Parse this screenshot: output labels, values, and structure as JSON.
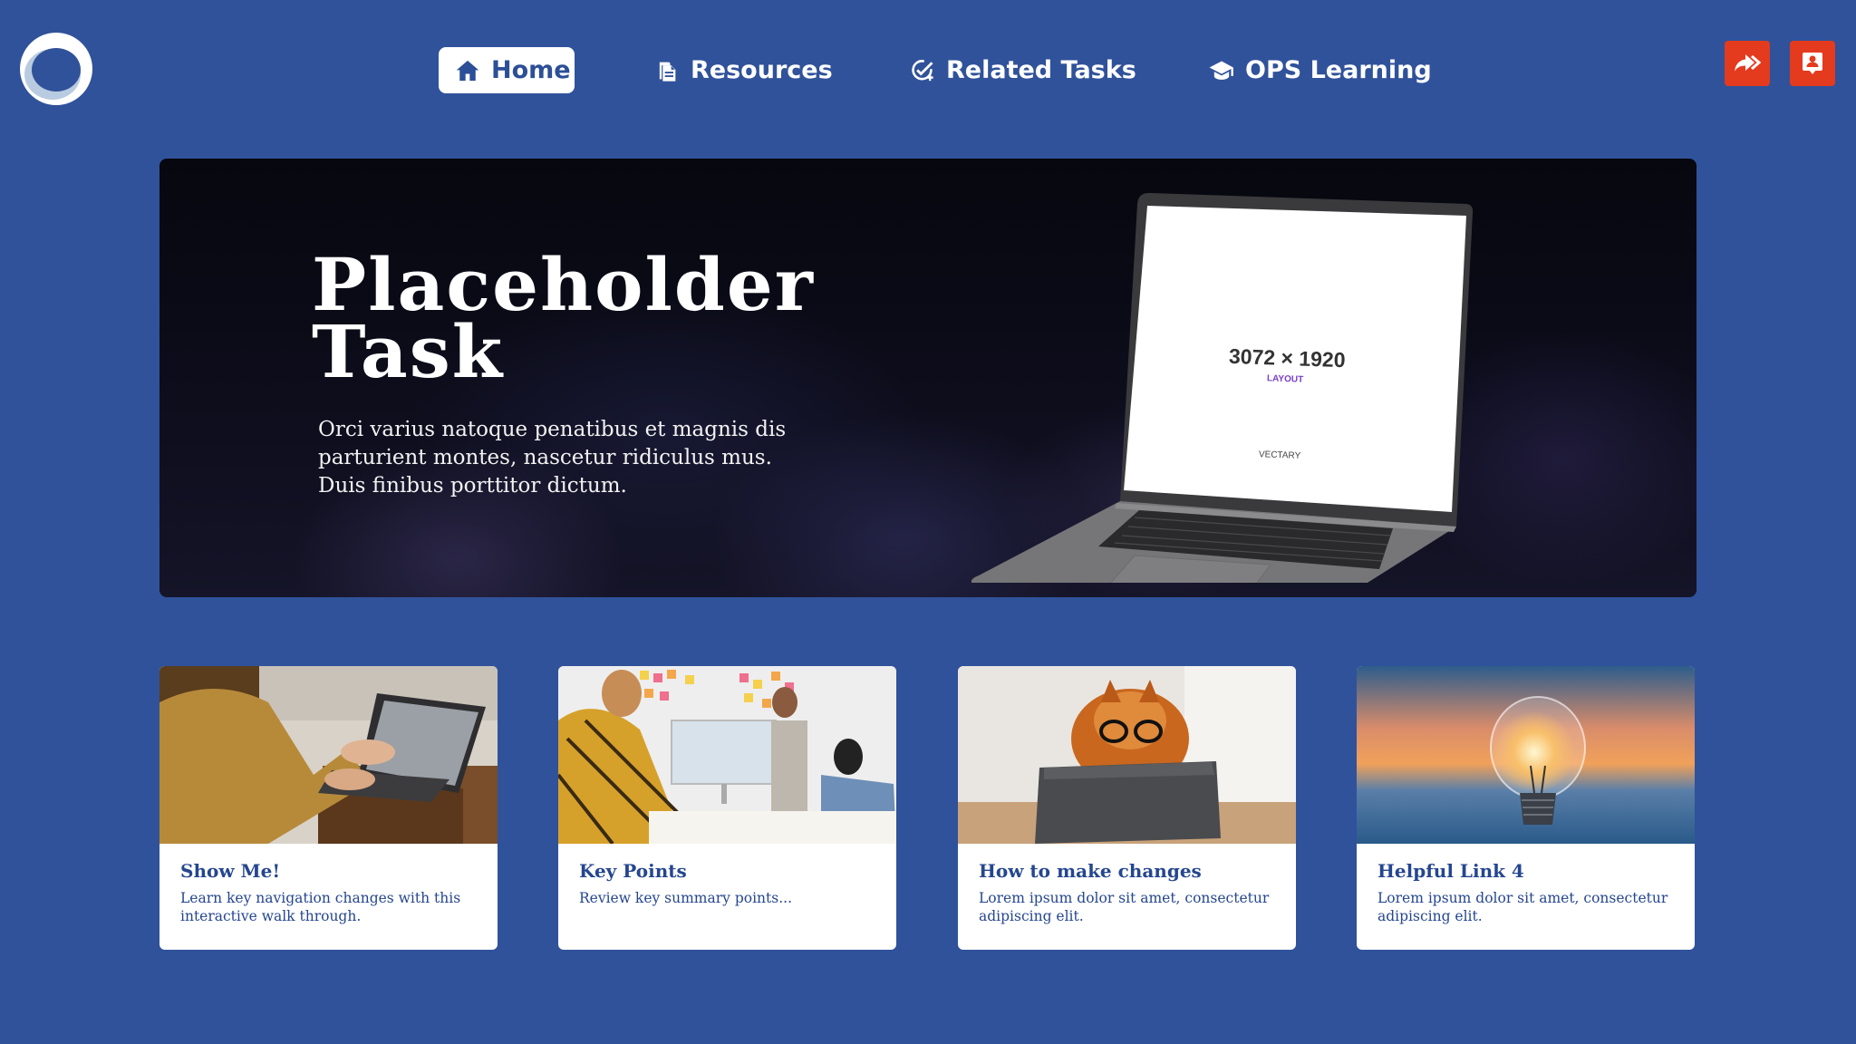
{
  "colors": {
    "background": "#30529a",
    "accent_red": "#e43a1e",
    "card_text": "#25468f",
    "nav_active_bg": "#ffffff"
  },
  "header": {
    "logo_icon": "ring-logo-icon",
    "nav": [
      {
        "label": "Home",
        "icon": "home-icon",
        "active": true
      },
      {
        "label": "Resources",
        "icon": "document-icon",
        "active": false
      },
      {
        "label": "Related Tasks",
        "icon": "check-badge-icon",
        "active": false
      },
      {
        "label": "OPS Learning",
        "icon": "graduation-cap-icon",
        "active": false
      }
    ],
    "actions": [
      {
        "icon": "share-forward-icon"
      },
      {
        "icon": "contact-card-icon"
      }
    ]
  },
  "hero": {
    "title": "Placeholder Task",
    "text": "Orci varius natoque penatibus et magnis dis parturient montes, nascetur ridiculus mus. Duis finibus porttitor dictum.",
    "screen_size": "3072 × 1920",
    "screen_layout": "LAYOUT",
    "screen_brand": "VECTARY"
  },
  "cards": [
    {
      "title": "Show Me!",
      "description": "Learn key navigation changes with this interactive walk through.",
      "image": "typing-laptop-photo"
    },
    {
      "title": "Key Points",
      "description": "Review key summary points...",
      "image": "meeting-whiteboard-photo"
    },
    {
      "title": "How to make changes",
      "description": "Lorem ipsum dolor sit amet, consectetur adipiscing elit.",
      "image": "dog-with-tablet-photo"
    },
    {
      "title": "Helpful Link 4",
      "description": "Lorem ipsum dolor sit amet, consectetur adipiscing elit.",
      "image": "lightbulb-sunset-photo"
    }
  ]
}
